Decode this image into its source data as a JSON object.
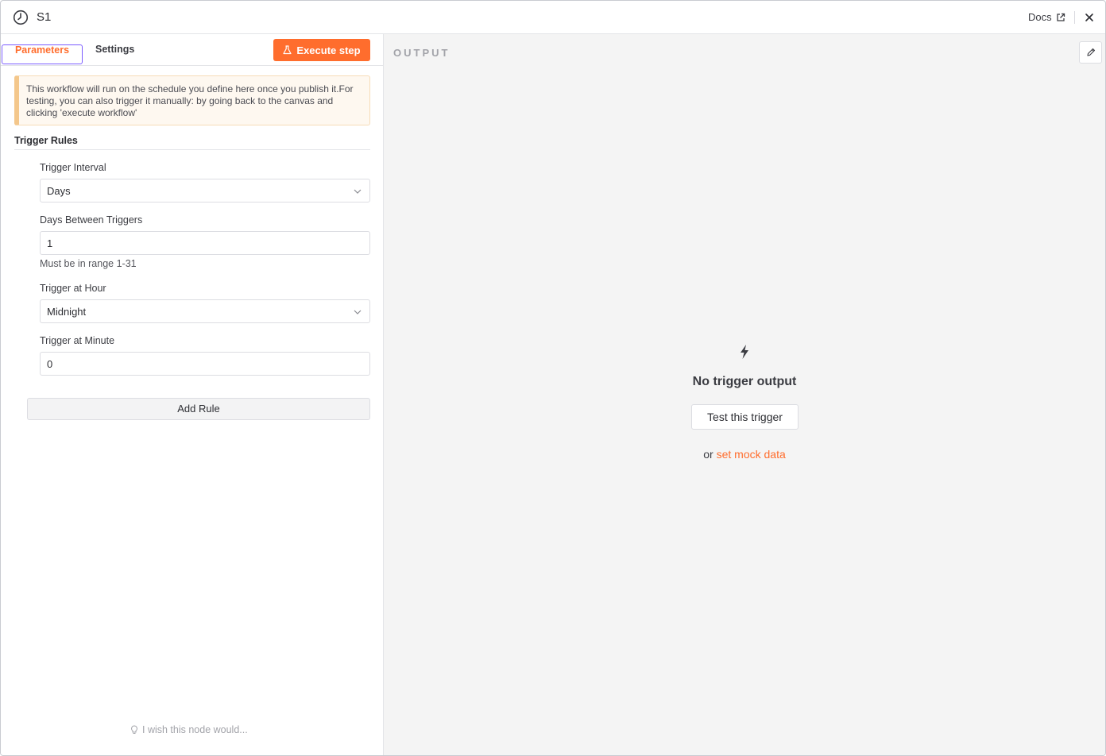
{
  "header": {
    "title": "S1",
    "docs_label": "Docs"
  },
  "tabs": {
    "parameters": "Parameters",
    "settings": "Settings"
  },
  "execute_step_label": "Execute step",
  "notice": "This workflow will run on the schedule you define here once you publish it.For testing, you can also trigger it manually: by going back to the canvas and clicking 'execute workflow'",
  "trigger_rules": {
    "title": "Trigger Rules",
    "interval_label": "Trigger Interval",
    "interval_value": "Days",
    "days_between_label": "Days Between Triggers",
    "days_between_value": "1",
    "days_between_hint": "Must be in range 1-31",
    "hour_label": "Trigger at Hour",
    "hour_value": "Midnight",
    "minute_label": "Trigger at Minute",
    "minute_value": "0",
    "add_rule_label": "Add Rule"
  },
  "wish_label": "I wish this node would...",
  "output": {
    "title": "OUTPUT",
    "empty_title": "No trigger output",
    "test_button": "Test this trigger",
    "or_text": "or",
    "mock_link": "set mock data"
  },
  "colors": {
    "accent": "#ff6d2d",
    "focus_outline": "#7b5cff",
    "notice_bg": "#fef8f0",
    "output_bg": "#f4f4f4"
  }
}
